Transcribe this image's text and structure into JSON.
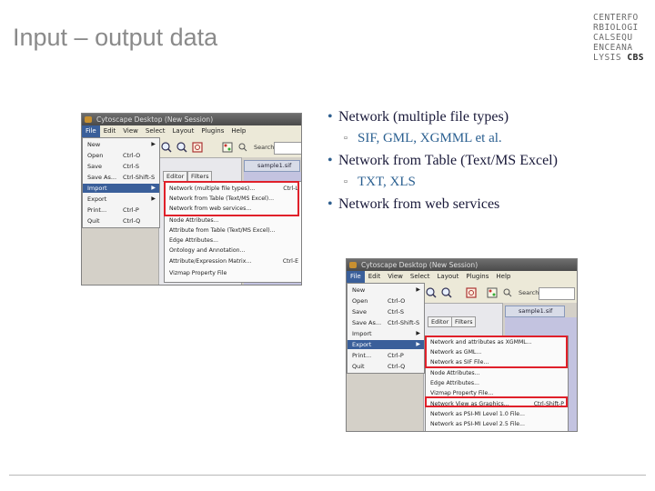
{
  "slide": {
    "title": "Input – output data",
    "logo_lines": [
      "CENTERFO",
      "RBIOLOGI",
      "CALSEQU",
      "ENCEANA",
      "LYSIS",
      "CBS"
    ]
  },
  "bullets": [
    {
      "text": "Network (multiple file types)",
      "sub": [
        "SIF, GML, XGMML et al."
      ]
    },
    {
      "text": "Network from Table (Text/MS Excel)",
      "sub": [
        "TXT, XLS"
      ]
    },
    {
      "text": "Network from web services",
      "sub": []
    }
  ],
  "screenshot_import": {
    "window_title": "Cytoscape Desktop (New Session)",
    "menubar": [
      "File",
      "Edit",
      "View",
      "Select",
      "Layout",
      "Plugins",
      "Help"
    ],
    "search_label": "Search:",
    "doc_tab": "sample1.sif",
    "panel_tabs": [
      "Editor",
      "Filters"
    ],
    "file_menu": [
      {
        "label": "New",
        "shortcut": "",
        "arrow": true
      },
      {
        "label": "Open",
        "shortcut": "Ctrl-O"
      },
      {
        "label": "Save",
        "shortcut": "Ctrl-S"
      },
      {
        "label": "Save As...",
        "shortcut": "Ctrl-Shift-S"
      },
      {
        "label": "Import",
        "shortcut": "",
        "arrow": true,
        "highlight": true
      },
      {
        "label": "Export",
        "shortcut": "",
        "arrow": true
      },
      {
        "label": "Print...",
        "shortcut": "Ctrl-P"
      },
      {
        "label": "Quit",
        "shortcut": "Ctrl-Q"
      }
    ],
    "import_submenu": [
      {
        "label": "Network (multiple file types)...",
        "shortcut": "Ctrl-L"
      },
      {
        "label": "Network from Table (Text/MS Excel)...",
        "shortcut": ""
      },
      {
        "label": "Network from web services...",
        "shortcut": ""
      },
      {
        "label": "Node Attributes...",
        "shortcut": ""
      },
      {
        "label": "Attribute from Table (Text/MS Excel)...",
        "shortcut": ""
      },
      {
        "label": "Edge Attributes...",
        "shortcut": ""
      },
      {
        "label": "Ontology and Annotation...",
        "shortcut": ""
      },
      {
        "label": "Attribute/Expression Matrix...",
        "shortcut": "Ctrl-E"
      },
      {
        "label": "Vizmap Property File",
        "shortcut": ""
      }
    ]
  },
  "screenshot_export": {
    "window_title": "Cytoscape Desktop (New Session)",
    "menubar": [
      "File",
      "Edit",
      "View",
      "Select",
      "Layout",
      "Plugins",
      "Help"
    ],
    "search_label": "Search:",
    "doc_tab": "sample1.sif",
    "panel_tabs": [
      "Editor",
      "Filters"
    ],
    "file_menu": [
      {
        "label": "New",
        "shortcut": "",
        "arrow": true
      },
      {
        "label": "Open",
        "shortcut": "Ctrl-O"
      },
      {
        "label": "Save",
        "shortcut": "Ctrl-S"
      },
      {
        "label": "Save As...",
        "shortcut": "Ctrl-Shift-S"
      },
      {
        "label": "Import",
        "shortcut": "",
        "arrow": true
      },
      {
        "label": "Export",
        "shortcut": "",
        "arrow": true,
        "highlight": true
      },
      {
        "label": "Print...",
        "shortcut": "Ctrl-P"
      },
      {
        "label": "Quit",
        "shortcut": "Ctrl-Q"
      }
    ],
    "export_submenu": [
      {
        "label": "Network and attributes as XGMML...",
        "shortcut": ""
      },
      {
        "label": "Network as GML...",
        "shortcut": ""
      },
      {
        "label": "Network as SIF File...",
        "shortcut": ""
      },
      {
        "label": "Node Attributes...",
        "shortcut": ""
      },
      {
        "label": "Edge Attributes...",
        "shortcut": ""
      },
      {
        "label": "Vizmap Property File...",
        "shortcut": ""
      },
      {
        "label": "Network View as Graphics...",
        "shortcut": "Ctrl-Shift-P"
      },
      {
        "label": "Network as PSI-MI Level 1.0 File...",
        "shortcut": ""
      },
      {
        "label": "Network as PSI-MI Level 2.5 File...",
        "shortcut": ""
      }
    ]
  },
  "colors": {
    "highlight_box": "#e0202a",
    "menu_highlight": "#3a5f9a",
    "title_gray": "#8a8a8a"
  }
}
